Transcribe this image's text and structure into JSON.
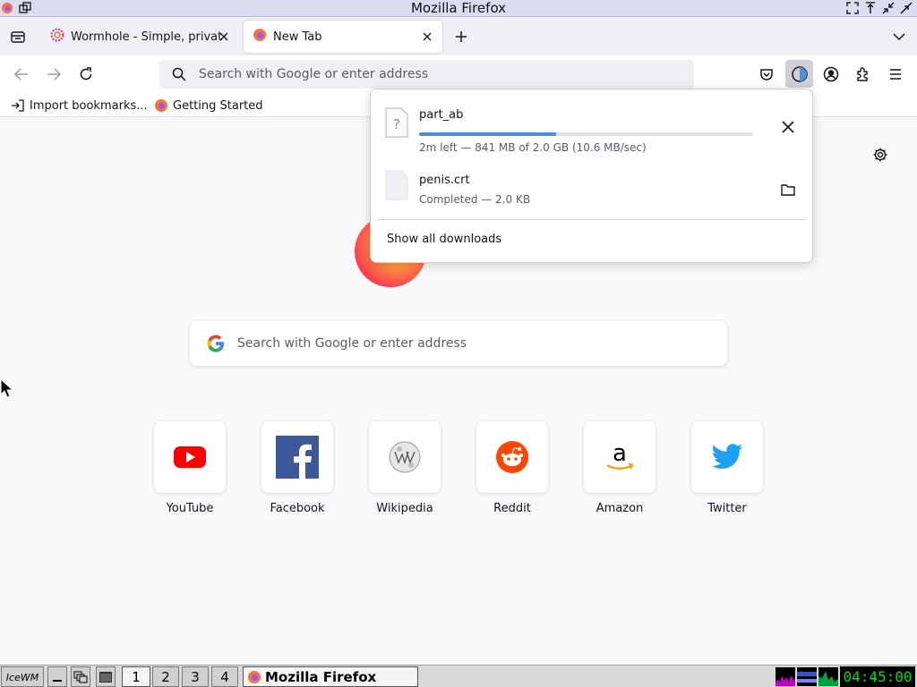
{
  "window": {
    "title": "Mozilla Firefox"
  },
  "tabs": [
    {
      "label": "Wormhole - Simple, privat",
      "active": false
    },
    {
      "label": "New Tab",
      "active": true
    }
  ],
  "urlbar": {
    "placeholder": "Search with Google or enter address"
  },
  "bookmarks": [
    {
      "label": "Import bookmarks..."
    },
    {
      "label": "Getting Started"
    }
  ],
  "downloads": {
    "items": [
      {
        "name": "part_ab",
        "status": "2m left — 841 MB of 2.0 GB (10.6 MB/sec)",
        "progress": 0.41,
        "action": "cancel"
      },
      {
        "name": "penis.crt",
        "status": "Completed — 2.0 KB",
        "action": "open-folder"
      }
    ],
    "show_all_label": "Show all downloads"
  },
  "newtab": {
    "search_placeholder": "Search with Google or enter address",
    "topsites": [
      {
        "label": "YouTube",
        "icon": "youtube-icon"
      },
      {
        "label": "Facebook",
        "icon": "facebook-icon"
      },
      {
        "label": "Wikipedia",
        "icon": "wikipedia-icon"
      },
      {
        "label": "Reddit",
        "icon": "reddit-icon"
      },
      {
        "label": "Amazon",
        "icon": "amazon-icon"
      },
      {
        "label": "Twitter",
        "icon": "twitter-icon"
      }
    ]
  },
  "taskbar": {
    "workspaces": [
      "1",
      "2",
      "3",
      "4"
    ],
    "active_workspace": "1",
    "task_label": "Mozilla Firefox",
    "clock": "04:45:00"
  },
  "colors": {
    "progress": "#4d8fdd",
    "clock_text": "#00e000",
    "youtube": "#ff0000",
    "facebook": "#3b5998",
    "reddit": "#ff4500",
    "twitter": "#1da1f2"
  }
}
